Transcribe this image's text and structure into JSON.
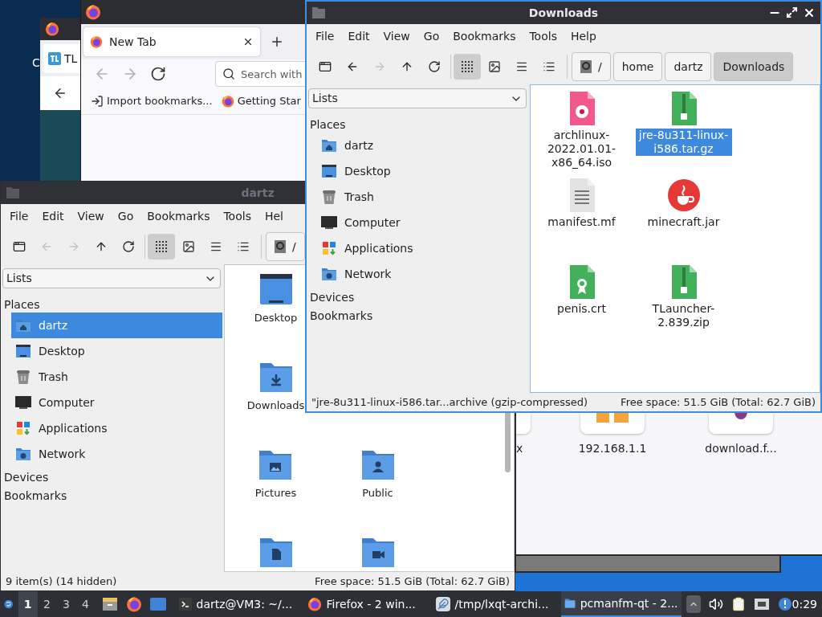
{
  "desktop": {
    "labels": [
      "C"
    ]
  },
  "back_browser": {
    "tab": {
      "label": "TL"
    }
  },
  "firefox": {
    "tabs": [
      {
        "label": "New Tab",
        "selected": true
      }
    ],
    "nav": [
      {
        "kind": "back",
        "disabled": true
      },
      {
        "kind": "forward",
        "disabled": true
      },
      {
        "kind": "reload",
        "disabled": false
      }
    ],
    "search": {
      "placeholder": "Search with"
    },
    "bookmarks": [
      {
        "kind": "import",
        "label": "Import bookmarks..."
      },
      {
        "kind": "firefox",
        "label": "Getting Star"
      }
    ]
  },
  "desktop_window": {
    "items": [
      {
        "kind": "generic",
        "label": "x"
      },
      {
        "kind": "folder",
        "label": "192.168.1.1"
      },
      {
        "kind": "web",
        "label": "download.f..."
      }
    ]
  },
  "file_manager": {
    "title": "dartz",
    "active": false,
    "menu": [
      "File",
      "Edit",
      "View",
      "Go",
      "Bookmarks",
      "Tools",
      "Hel"
    ],
    "nav": [
      {
        "kind": "new_window",
        "disabled": false
      },
      {
        "kind": "back",
        "disabled": true
      },
      {
        "kind": "forward",
        "disabled": true
      },
      {
        "kind": "up",
        "disabled": false
      },
      {
        "kind": "reload",
        "disabled": false
      }
    ],
    "view_modes": [
      {
        "kind": "icons",
        "selected": true
      },
      {
        "kind": "thumbnails",
        "selected": false
      },
      {
        "kind": "compact",
        "selected": false
      },
      {
        "kind": "details",
        "selected": false
      }
    ],
    "path": [
      {
        "kind": "root",
        "label": "/",
        "selected": false
      }
    ],
    "side_pane": {
      "lists": "Lists",
      "places_header": "Places",
      "places": [
        {
          "kind": "home",
          "label": "dartz",
          "selected": true
        },
        {
          "kind": "desktop",
          "label": "Desktop",
          "selected": false
        },
        {
          "kind": "trash",
          "label": "Trash",
          "selected": false
        },
        {
          "kind": "computer",
          "label": "Computer",
          "selected": false
        },
        {
          "kind": "applications",
          "label": "Applications",
          "selected": false
        },
        {
          "kind": "network",
          "label": "Network",
          "selected": false
        }
      ],
      "devices": "Devices",
      "bookmarks": "Bookmarks"
    },
    "file_rows": [
      [
        {
          "kind": "desktop",
          "label": "Desktop"
        }
      ],
      [
        {
          "kind": "downloads",
          "label": "Downloads"
        }
      ],
      [
        {
          "kind": "pictures",
          "label": "Pictures"
        },
        {
          "kind": "public",
          "label": "Public"
        }
      ],
      [
        {
          "kind": "documents"
        },
        {
          "kind": "videos"
        }
      ]
    ],
    "status": {
      "items": "9 item(s) (14 hidden)",
      "free_space": "Free space: 51.5 GiB (Total: 62.7 GiB)"
    }
  },
  "downloads_window": {
    "title": "Downloads",
    "active": true,
    "menu": [
      "File",
      "Edit",
      "View",
      "Go",
      "Bookmarks",
      "Tools",
      "Help"
    ],
    "nav": [
      {
        "kind": "new_window",
        "disabled": false
      },
      {
        "kind": "back",
        "disabled": false
      },
      {
        "kind": "forward",
        "disabled": true
      },
      {
        "kind": "up",
        "disabled": false
      },
      {
        "kind": "reload",
        "disabled": false
      }
    ],
    "view_modes": [
      {
        "kind": "icons",
        "selected": true
      },
      {
        "kind": "thumbnails",
        "selected": false
      },
      {
        "kind": "compact",
        "selected": false
      },
      {
        "kind": "details",
        "selected": false
      }
    ],
    "path": [
      {
        "kind": "root",
        "label": "/",
        "selected": false
      },
      {
        "kind": "folder",
        "label": "home",
        "selected": false
      },
      {
        "kind": "folder",
        "label": "dartz",
        "selected": false
      },
      {
        "kind": "folder",
        "label": "Downloads",
        "selected": true
      }
    ],
    "side_pane": {
      "lists": "Lists",
      "places_header": "Places",
      "places": [
        {
          "kind": "home",
          "label": "dartz",
          "selected": false
        },
        {
          "kind": "desktop",
          "label": "Desktop",
          "selected": false
        },
        {
          "kind": "trash",
          "label": "Trash",
          "selected": false
        },
        {
          "kind": "computer",
          "label": "Computer",
          "selected": false
        },
        {
          "kind": "applications",
          "label": "Applications",
          "selected": false
        },
        {
          "kind": "network",
          "label": "Network",
          "selected": false
        }
      ],
      "devices": "Devices",
      "bookmarks": "Bookmarks"
    },
    "files": [
      {
        "kind": "iso",
        "label": "archlinux-2022.01.01-x86_64.iso",
        "selected": false
      },
      {
        "kind": "archive",
        "label": "jre-8u311-linux-i586.tar.gz",
        "selected": true
      },
      {
        "kind": "text",
        "label": "manifest.mf",
        "selected": false
      },
      {
        "kind": "java",
        "label": "minecraft.jar",
        "selected": false
      },
      {
        "kind": "certificate",
        "label": "penis.crt",
        "selected": false
      },
      {
        "kind": "archive",
        "label": "TLauncher-2.839.zip",
        "selected": false
      }
    ],
    "status": {
      "selection": "\"jre-8u311-linux-i586.tar...archive (gzip-compressed)",
      "free_space": "Free space: 51.5 GiB (Total: 62.7 GiB)"
    }
  },
  "taskbar": {
    "desktops": [
      {
        "label": "1",
        "selected": true
      },
      {
        "label": "2",
        "selected": false
      },
      {
        "label": "3",
        "selected": false
      },
      {
        "label": "4",
        "selected": false
      }
    ],
    "launchers": [
      {
        "kind": "files"
      },
      {
        "kind": "firefox"
      },
      {
        "kind": "desktop"
      }
    ],
    "tasks": [
      {
        "kind": "terminal",
        "label": "dartz@VM3: ~/...",
        "selected": false
      },
      {
        "kind": "firefox",
        "label": "Firefox - 2 win...",
        "selected": false
      },
      {
        "kind": "archiver",
        "label": "/tmp/lxqt-archi...",
        "selected": false
      },
      {
        "kind": "files",
        "label": "pcmanfm-qt - 2...",
        "selected": true
      }
    ],
    "tray": [
      {
        "kind": "expand"
      },
      {
        "kind": "volume"
      },
      {
        "kind": "clipboard"
      },
      {
        "kind": "network"
      },
      {
        "kind": "notification"
      }
    ],
    "clock": "0:29"
  }
}
